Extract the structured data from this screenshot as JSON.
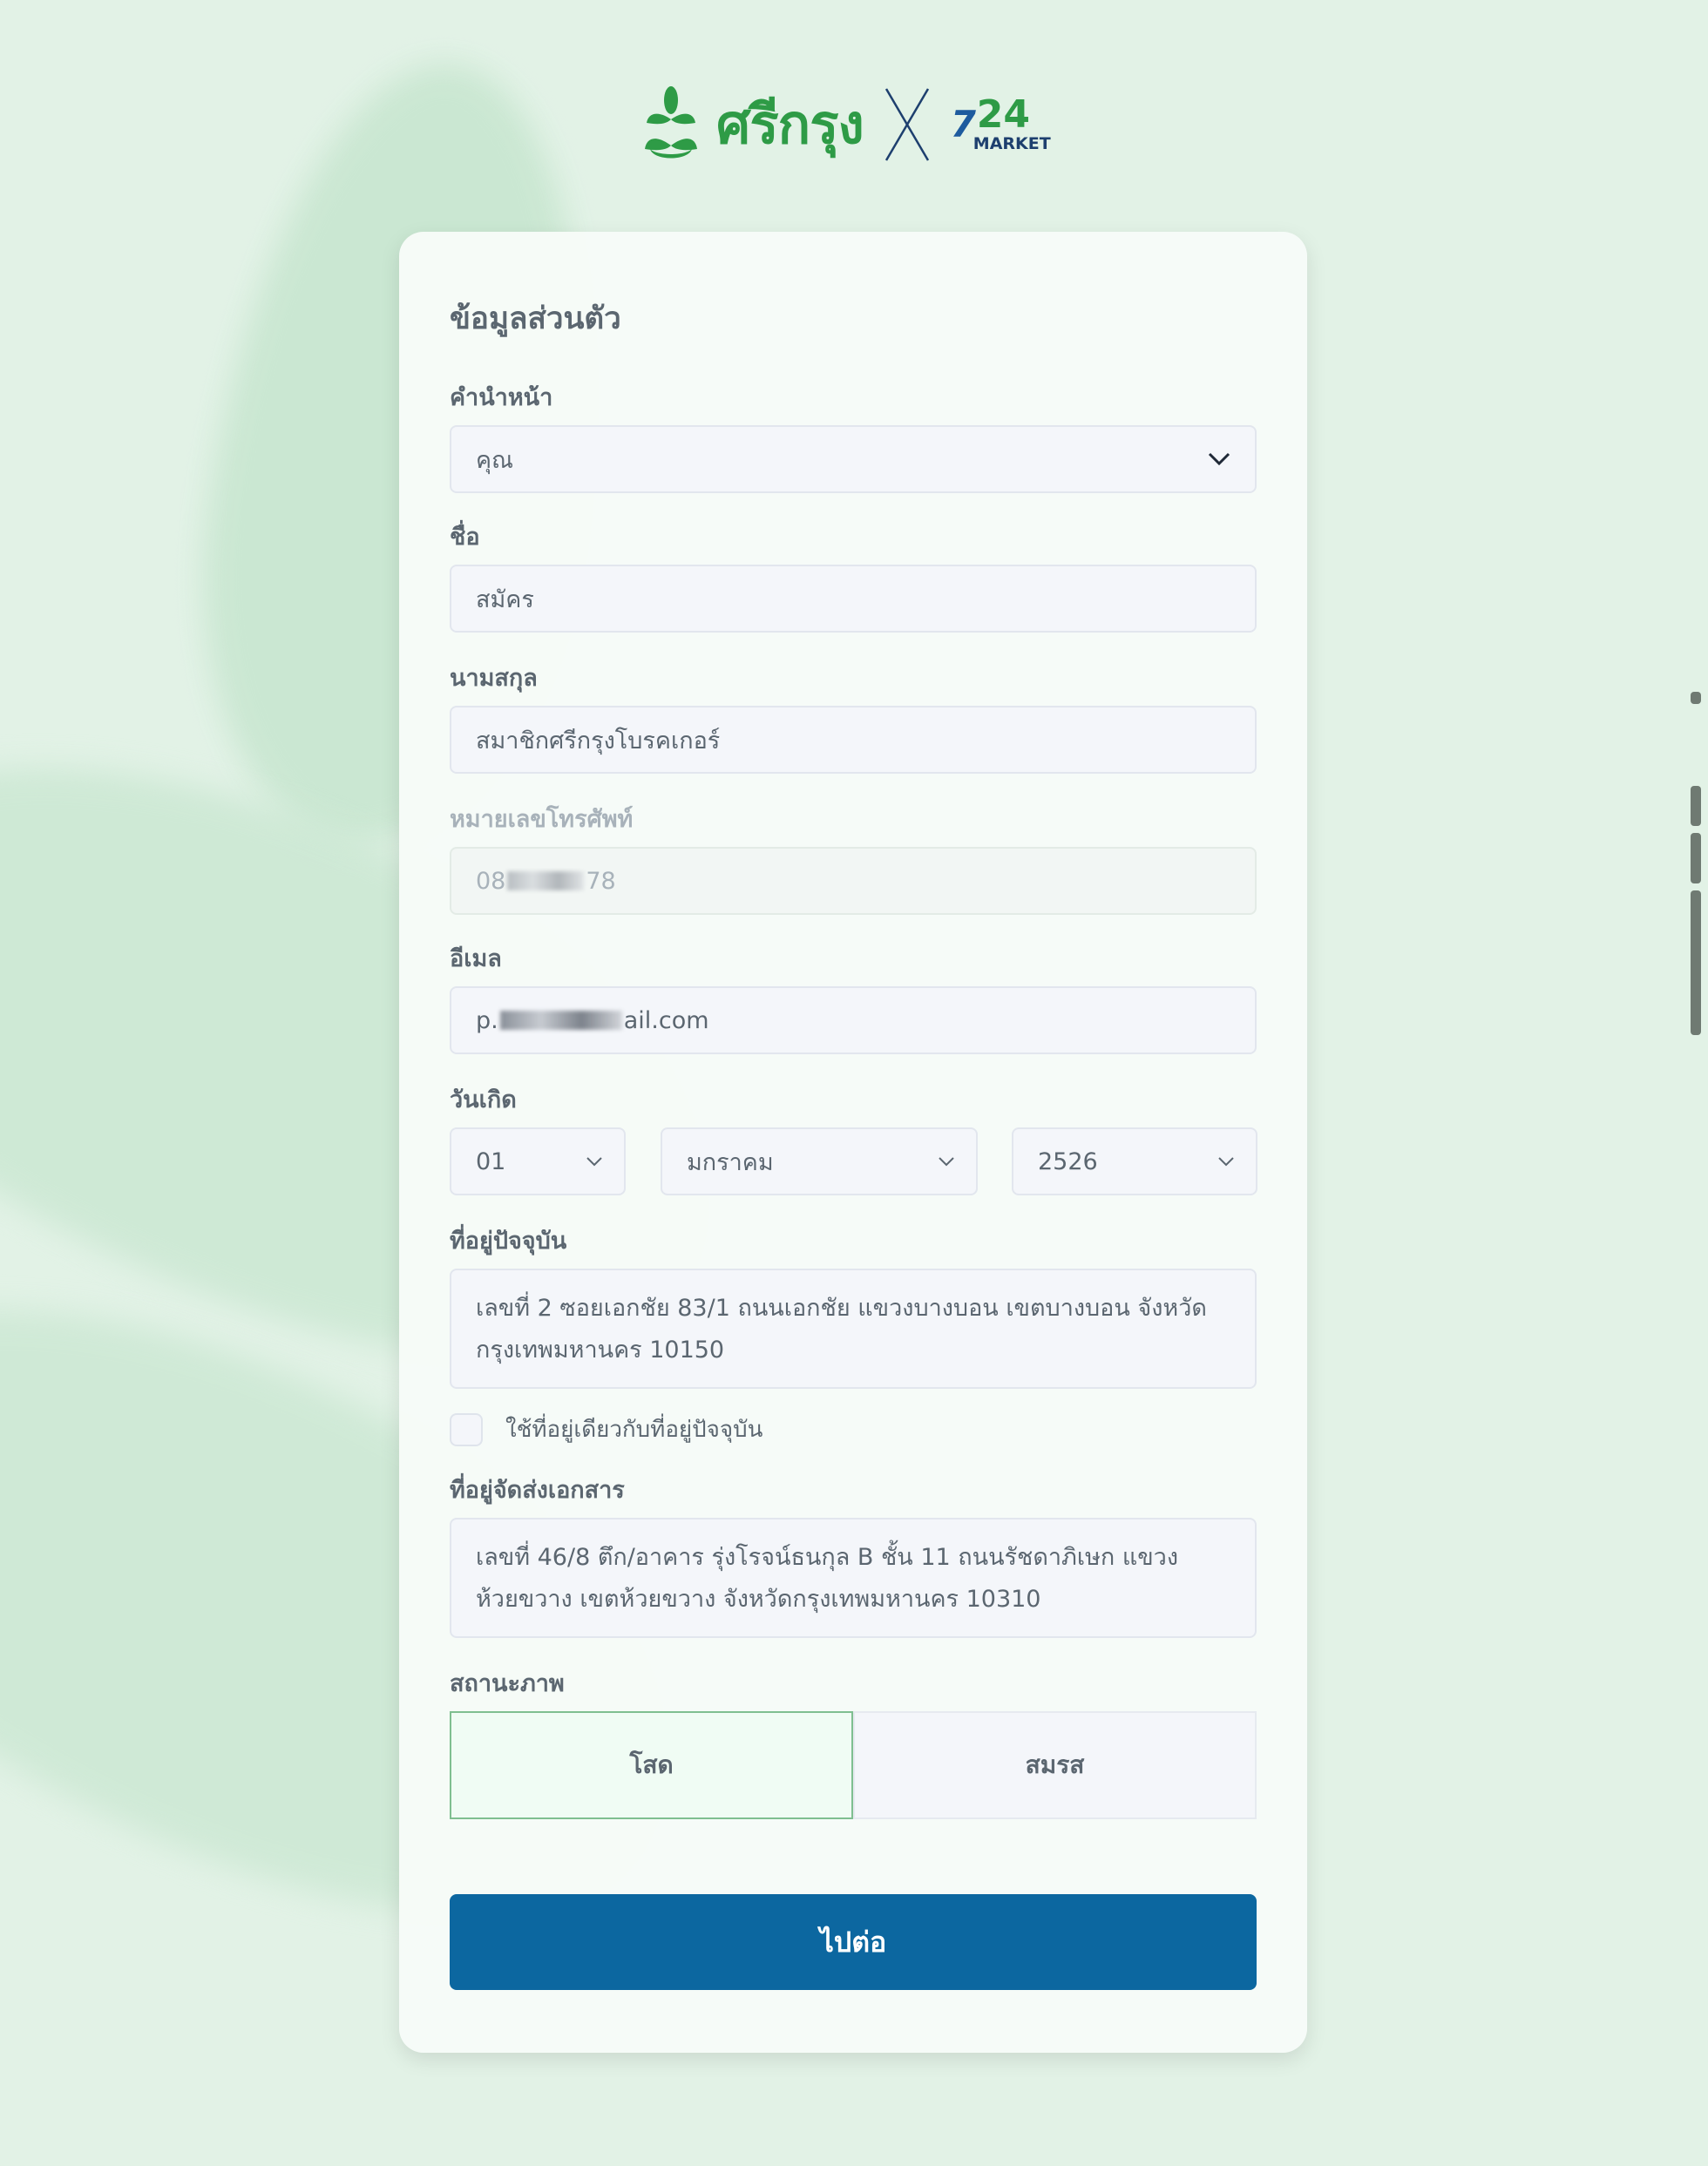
{
  "header": {
    "brand_name": "ศรีกรุง",
    "partner_number_seven": "7",
    "partner_number_24": "24",
    "partner_word": "MARKET"
  },
  "form": {
    "title": "ข้อมูลส่วนตัว",
    "prefix": {
      "label": "คำนำหน้า",
      "value": "คุณ"
    },
    "first_name": {
      "label": "ชื่อ",
      "value": "สมัคร"
    },
    "last_name": {
      "label": "นามสกุล",
      "value": "สมาชิกศรีกรุงโบรคเกอร์"
    },
    "phone": {
      "label": "หมายเลขโทรศัพท์",
      "value_start": "08",
      "value_end": "78"
    },
    "email": {
      "label": "อีเมล",
      "value_start": "p.",
      "value_end": "ail.com"
    },
    "birthday": {
      "label": "วันเกิด",
      "day": "01",
      "month": "มกราคม",
      "year": "2526"
    },
    "current_address": {
      "label": "ที่อยู่ปัจจุบัน",
      "value": "เลขที่ 2 ซอยเอกชัย 83/1 ถนนเอกชัย แขวงบางบอน เขตบางบอน จังหวัดกรุงเทพมหานคร 10150"
    },
    "same_address_checkbox": {
      "label": "ใช้ที่อยู่เดียวกับที่อยู่ปัจจุบัน",
      "checked": false
    },
    "mailing_address": {
      "label": "ที่อยู่จัดส่งเอกสาร",
      "value": "เลขที่ 46/8 ตึก/อาคาร รุ่งโรจน์ธนกุล B ชั้น 11 ถนนรัชดาภิเษก แขวงห้วยขวาง เขตห้วยขวาง จังหวัดกรุงเทพมหานคร 10310"
    },
    "marital_status": {
      "label": "สถานะภาพ",
      "options": [
        "โสด",
        "สมรส"
      ],
      "selected": "โสด"
    },
    "next_button": "ไปต่อ"
  },
  "colors": {
    "background": "#e2f2e6",
    "brand_green": "#2e9b46",
    "primary_button": "#0c67a0",
    "selected_border": "#7fbf90"
  }
}
